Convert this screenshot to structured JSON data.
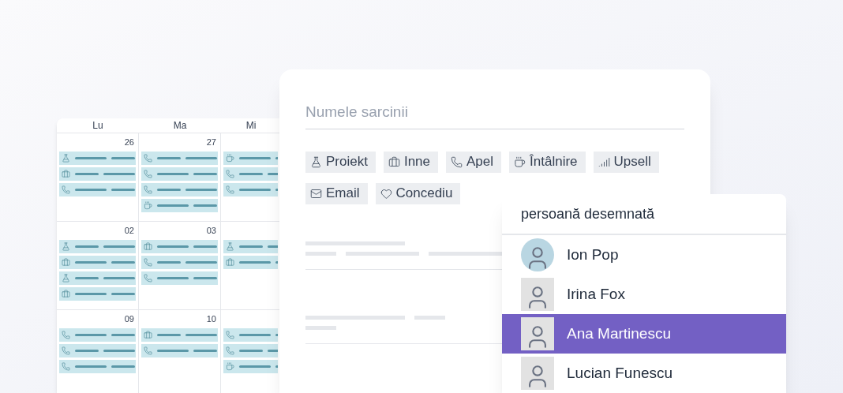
{
  "calendar": {
    "weekdays": [
      "Lu",
      "Ma",
      "Mi"
    ],
    "weeks": [
      {
        "days": [
          {
            "date": "26",
            "events": [
              {
                "kind": "proiekt"
              },
              {
                "kind": "inne"
              },
              {
                "kind": "apel"
              }
            ]
          },
          {
            "date": "27",
            "events": [
              {
                "kind": "apel"
              },
              {
                "kind": "apel"
              },
              {
                "kind": "apel"
              },
              {
                "kind": "intalnire"
              }
            ]
          },
          {
            "events": [
              {
                "kind": "intalnire"
              },
              {
                "kind": "apel"
              },
              {
                "kind": "apel"
              }
            ]
          }
        ]
      },
      {
        "days": [
          {
            "date": "02",
            "events": [
              {
                "kind": "proiekt"
              },
              {
                "kind": "inne"
              },
              {
                "kind": "proiekt"
              },
              {
                "kind": "inne"
              }
            ]
          },
          {
            "date": "03",
            "events": [
              {
                "kind": "inne"
              },
              {
                "kind": "apel"
              },
              {
                "kind": "apel"
              }
            ]
          },
          {
            "events": [
              {
                "kind": "proiekt"
              },
              {
                "kind": "inne"
              }
            ]
          }
        ]
      },
      {
        "days": [
          {
            "date": "09",
            "events": [
              {
                "kind": "apel"
              },
              {
                "kind": "apel"
              },
              {
                "kind": "apel"
              }
            ]
          },
          {
            "date": "10",
            "events": [
              {
                "kind": "inne"
              },
              {
                "kind": "apel"
              }
            ]
          },
          {
            "events": [
              {
                "kind": "apel"
              },
              {
                "kind": "apel"
              },
              {
                "kind": "intalnire"
              }
            ]
          }
        ]
      }
    ]
  },
  "task_form": {
    "name_placeholder": "Numele sarcinii",
    "tags": [
      {
        "kind": "proiekt",
        "label": "Proiekt"
      },
      {
        "kind": "inne",
        "label": "Inne"
      },
      {
        "kind": "apel",
        "label": "Apel"
      },
      {
        "kind": "intalnire",
        "label": "Întâlnire"
      },
      {
        "kind": "upsell",
        "label": "Upsell"
      },
      {
        "kind": "email",
        "label": "Email"
      },
      {
        "kind": "concediu",
        "label": "Concediu"
      }
    ]
  },
  "assignee_dropdown": {
    "title": "persoană desemnată",
    "people": [
      {
        "name": "Ion Pop",
        "kind": "circle",
        "selected": false
      },
      {
        "name": "Irina Fox",
        "kind": "square",
        "selected": false
      },
      {
        "name": "Ana Martinescu",
        "kind": "square",
        "selected": true
      },
      {
        "name": "Lucian Funescu",
        "kind": "square",
        "selected": false
      }
    ]
  }
}
